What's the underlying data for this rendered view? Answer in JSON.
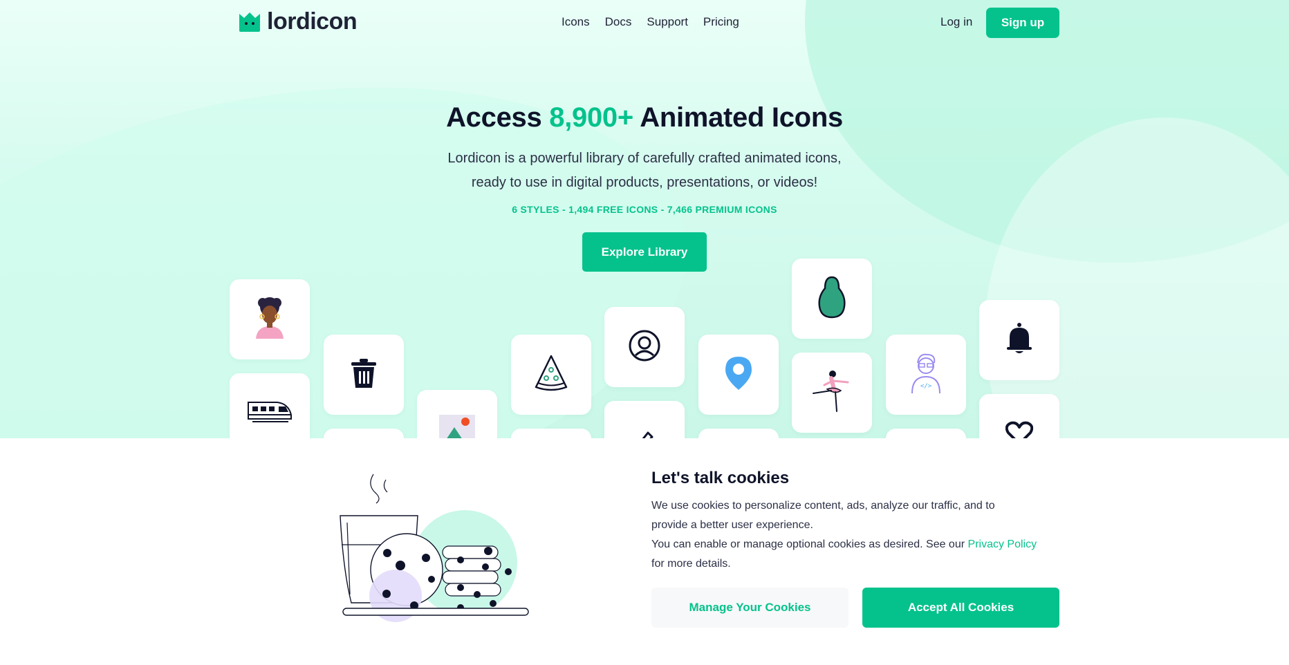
{
  "brand": {
    "name": "lordicon",
    "accent": "#05c28c"
  },
  "nav": {
    "items": [
      "Icons",
      "Docs",
      "Support",
      "Pricing"
    ]
  },
  "auth": {
    "login": "Log in",
    "signup": "Sign up"
  },
  "hero": {
    "title_pre": "Access",
    "title_accent": "8,900+",
    "title_post": "Animated Icons",
    "subtitle_line1": "Lordicon is a powerful library of carefully crafted animated icons,",
    "subtitle_line2": "ready to use in digital products, presentations, or videos!",
    "stats": "6 STYLES - 1,494 FREE ICONS - 7,466 PREMIUM ICONS",
    "cta": "Explore Library"
  },
  "icon_tiles": [
    "woman-avatar-icon",
    "train-icon",
    "trash-icon",
    "image-icon",
    "pizza-slice-icon",
    "user-circle-icon",
    "pencil-icon",
    "location-pin-icon",
    "avocado-icon",
    "ballerina-icon",
    "developer-icon",
    "bell-icon",
    "heart-icon"
  ],
  "cookies": {
    "title": "Let's talk cookies",
    "text_line1": "We use cookies to personalize content, ads, analyze our traffic, and to",
    "text_line2": "provide a better user experience.",
    "text_line3_pre": "You can enable or manage optional cookies as desired. See our",
    "privacy_link": "Privacy Policy",
    "text_line4": "for more details.",
    "manage": "Manage Your Cookies",
    "accept": "Accept All Cookies"
  }
}
